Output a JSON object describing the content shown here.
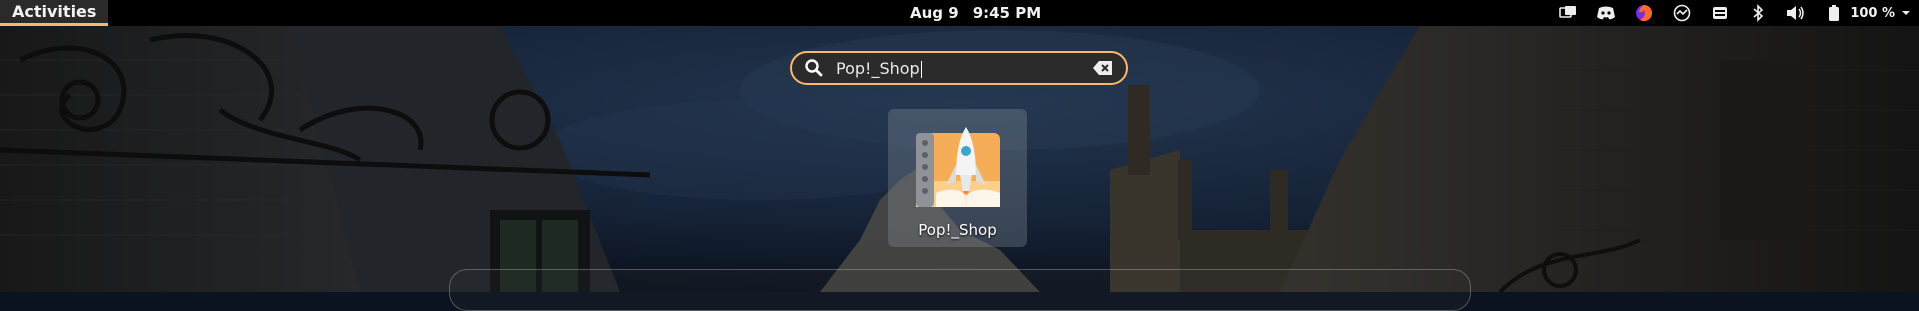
{
  "topbar": {
    "activities_label": "Activities",
    "date": "Aug 9",
    "time": "9:45 PM",
    "tray_icons": [
      "workspaces-icon",
      "discord-icon",
      "firefox-icon",
      "app-indicator-icon",
      "keyboard-icon",
      "bluetooth-icon",
      "volume-icon",
      "battery-icon"
    ],
    "battery_percent": "100 %"
  },
  "search": {
    "value": "Pop!_Shop",
    "accent_color": "#fbb86c"
  },
  "results": [
    {
      "label": "Pop!_Shop",
      "icon": "pop-shop-rocket-icon"
    }
  ]
}
